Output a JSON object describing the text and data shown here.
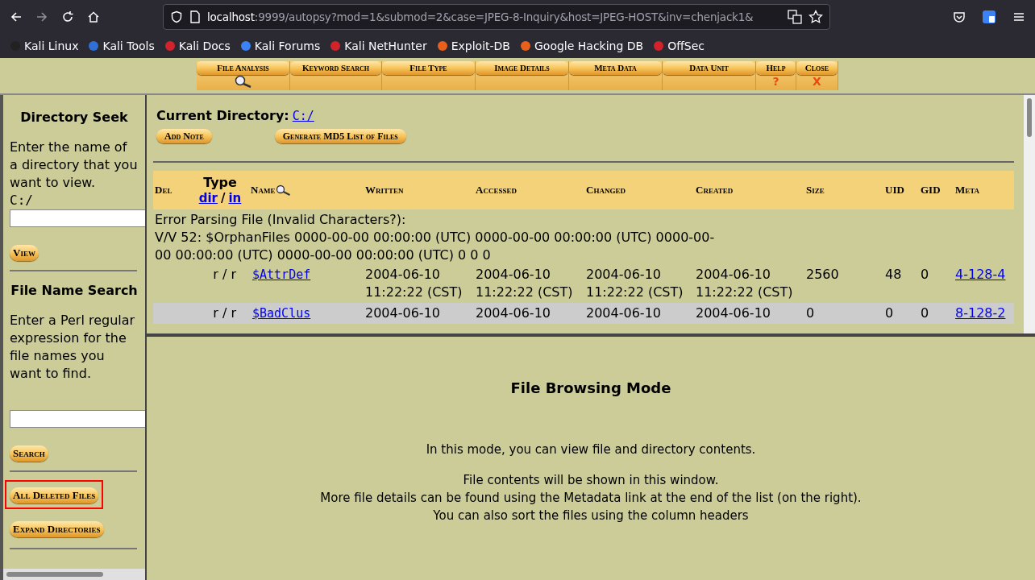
{
  "browser": {
    "url_host": "localhost",
    "url_rest": ":9999/autopsy?mod=1&submod=2&case=JPEG-8-Inquiry&host=JPEG-HOST&inv=chenjack1&",
    "bookmarks": [
      {
        "label": "Kali Linux",
        "color": "#222222"
      },
      {
        "label": "Kali Tools",
        "color": "#2f6fd6"
      },
      {
        "label": "Kali Docs",
        "color": "#d2232a"
      },
      {
        "label": "Kali Forums",
        "color": "#3b82f6"
      },
      {
        "label": "Kali NetHunter",
        "color": "#d2232a"
      },
      {
        "label": "Exploit-DB",
        "color": "#e8601c"
      },
      {
        "label": "Google Hacking DB",
        "color": "#e8601c"
      },
      {
        "label": "OffSec",
        "color": "#d2232a"
      }
    ]
  },
  "nav": [
    {
      "label": "File Analysis",
      "kind": "search"
    },
    {
      "label": "Keyword Search",
      "kind": "none"
    },
    {
      "label": "File Type",
      "kind": "none"
    },
    {
      "label": "Image Details",
      "kind": "none"
    },
    {
      "label": "Meta Data",
      "kind": "none"
    },
    {
      "label": "Data Unit",
      "kind": "none"
    },
    {
      "label": "Help",
      "kind": "glyph",
      "glyph": "?"
    },
    {
      "label": "Close",
      "kind": "glyph",
      "glyph": "X"
    }
  ],
  "sidebar": {
    "dir_seek": {
      "title": "Directory Seek",
      "text": "Enter the name of a directory that you want to view.",
      "path": "C:/",
      "button": "View"
    },
    "name_search": {
      "title": "File Name Search",
      "text": "Enter a Perl regular expression for the file names you want to find.",
      "button": "Search"
    },
    "actions": [
      {
        "label": "All Deleted Files",
        "highlighted": true
      },
      {
        "label": "Expand Directories",
        "highlighted": false
      }
    ]
  },
  "listing": {
    "current_label": "Current Directory:",
    "current_path": "C:/",
    "buttons": [
      "Add Note",
      "Generate MD5 List of Files"
    ],
    "columns": {
      "del": "Del",
      "type": "Type",
      "type_dir": "dir",
      "type_sep": "/",
      "type_in": "in",
      "name": "Name",
      "written": "Written",
      "accessed": "Accessed",
      "changed": "Changed",
      "created": "Created",
      "size": "Size",
      "uid": "UID",
      "gid": "GID",
      "meta": "Meta"
    },
    "error": "Error Parsing File (Invalid Characters?):\nV/V 52: $OrphanFiles 0000-00-00 00:00:00 (UTC) 0000-00-00 00:00:00 (UTC) 0000-00-00 00:00:00 (UTC) 0000-00-00 00:00:00 (UTC) 0 0 0",
    "rows": [
      {
        "type": "r / r",
        "name": "$AttrDef",
        "written": "2004-06-10 11:22:22 (CST)",
        "accessed": "2004-06-10 11:22:22 (CST)",
        "changed": "2004-06-10 11:22:22 (CST)",
        "created": "2004-06-10 11:22:22 (CST)",
        "size": "2560",
        "uid": "48",
        "gid": "0",
        "meta": "4-128-4",
        "shaded": false
      },
      {
        "type": "r / r",
        "name": "$BadClus",
        "written": "2004-06-10",
        "accessed": "2004-06-10",
        "changed": "2004-06-10",
        "created": "2004-06-10",
        "size": "0",
        "uid": "0",
        "gid": "0",
        "meta": "8-128-2",
        "shaded": true
      }
    ]
  },
  "info": {
    "title": "File Browsing Mode",
    "paragraphs": [
      "In this mode, you can view file and directory contents.",
      "File contents will be shown in this window.\nMore file details can be found using the Metadata link at the end of the list (on the right).\nYou can also sort the files using the column headers"
    ]
  }
}
